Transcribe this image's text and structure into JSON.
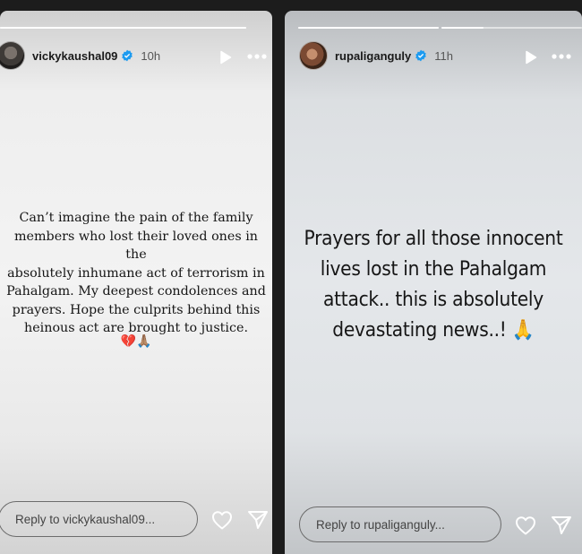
{
  "stories": [
    {
      "username": "vickykaushal09",
      "time": "10h",
      "text_lines": [
        "Can’t imagine the pain of the family",
        "members who lost their loved ones in the",
        "absolutely inhumane act of terrorism in",
        "Pahalgam. My deepest condolences and",
        "prayers. Hope the culprits behind this",
        "heinous act are brought to justice."
      ],
      "emojis": "💔🙏🏽",
      "reply_placeholder": "Reply to vickykaushal09..."
    },
    {
      "username": "rupaliganguly",
      "time": "11h",
      "text_lines": [
        "Prayers for all those innocent",
        "lives lost in the Pahalgam",
        "attack.. this is absolutely",
        "devastating news..! 🙏"
      ],
      "reply_placeholder": "Reply to rupaliganguly..."
    }
  ],
  "icons": {
    "verified": "verified-badge-icon",
    "play": "play-icon",
    "more": "more-options-icon",
    "like": "heart-icon",
    "share": "send-icon"
  },
  "colors": {
    "verified_badge": "#1d9bf0",
    "icon": "#ffffff"
  }
}
